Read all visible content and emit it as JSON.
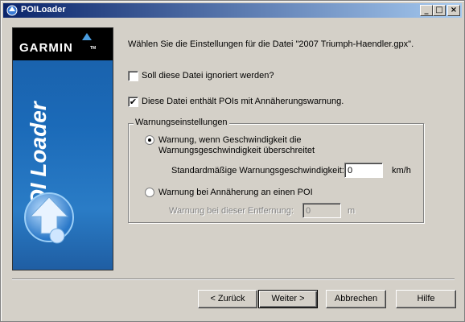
{
  "window": {
    "title": "POILoader",
    "controls": {
      "minimize": "_",
      "maximize": "□",
      "close": "×"
    }
  },
  "banner": {
    "brand": "GARMIN",
    "trademark": "TM",
    "product": "POI Loader"
  },
  "intro": "Wählen Sie die Einstellungen für die Datei \"2007 Triumph-Haendler.gpx\".",
  "options": {
    "ignore_file": {
      "label": "Soll diese Datei ignoriert werden?",
      "checked": false
    },
    "proximity": {
      "label": "Diese Datei enthält POIs mit Annäherungswarnung.",
      "checked": true
    }
  },
  "warnings": {
    "group_title": "Warnungseinstellungen",
    "speed_option": {
      "label_line1": "Warnung, wenn Geschwindigkeit die",
      "label_line2": "Warnungsgeschwindigkeit überschreitet",
      "selected": true
    },
    "default_speed": {
      "label": "Standardmäßige Warnungsgeschwindigkeit:",
      "value": "0",
      "unit": "km/h"
    },
    "approach_option": {
      "label": "Warnung bei Annäherung an einen POI",
      "selected": false
    },
    "distance": {
      "label": "Warnung bei dieser Entfernung:",
      "value": "0",
      "unit": "m"
    }
  },
  "buttons": {
    "back": "< Zurück",
    "next": "Weiter >",
    "cancel": "Abbrechen",
    "help": "Hilfe"
  }
}
